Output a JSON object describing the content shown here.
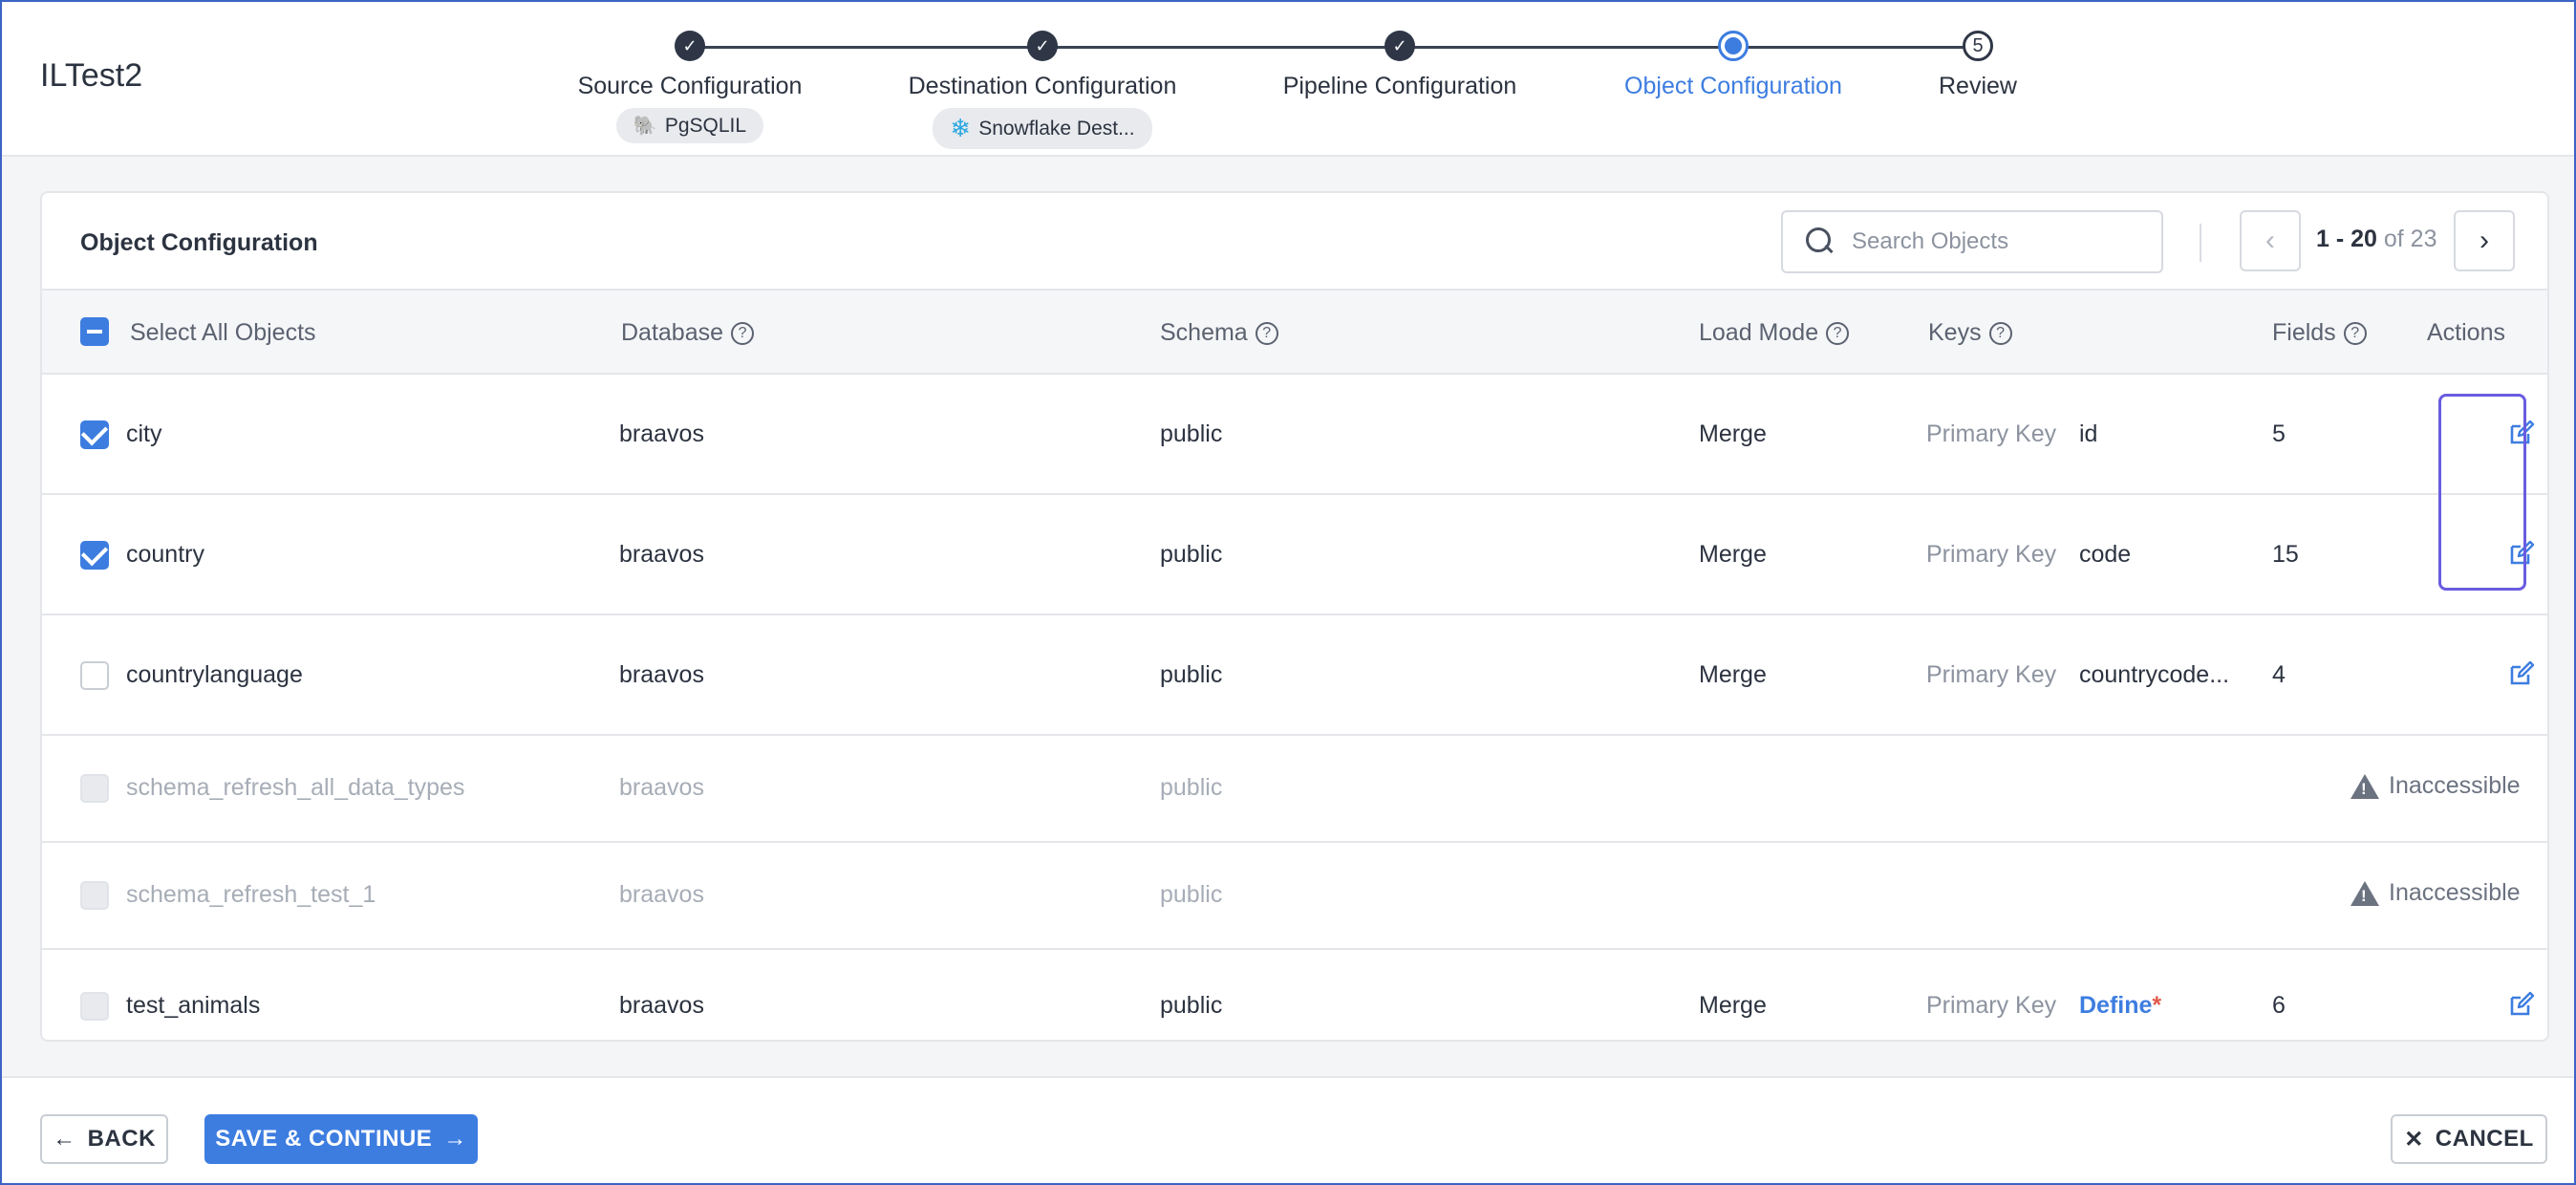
{
  "app": {
    "title": "ILTest2"
  },
  "stepper": [
    {
      "label": "Source Configuration",
      "state": "done",
      "chip": "PgSQLIL",
      "chip_icon": "postgres-icon"
    },
    {
      "label": "Destination Configuration",
      "state": "done",
      "chip": "Snowflake Dest...",
      "chip_icon": "snowflake-icon"
    },
    {
      "label": "Pipeline Configuration",
      "state": "done"
    },
    {
      "label": "Object Configuration",
      "state": "current"
    },
    {
      "label": "Review",
      "state": "pending",
      "number": "5"
    }
  ],
  "card": {
    "title": "Object Configuration",
    "search_placeholder": "Search Objects",
    "pagination": {
      "range": "1 - 20",
      "total": "of 23"
    }
  },
  "table": {
    "headers": {
      "select_all": "Select All Objects",
      "database": "Database",
      "schema": "Schema",
      "load_mode": "Load Mode",
      "keys": "Keys",
      "fields": "Fields",
      "actions": "Actions"
    },
    "rows": [
      {
        "name": "city",
        "database": "braavos",
        "schema": "public",
        "load_mode": "Merge",
        "key_type": "Primary Key",
        "key": "id",
        "fields": "5",
        "checked": true
      },
      {
        "name": "country",
        "database": "braavos",
        "schema": "public",
        "load_mode": "Merge",
        "key_type": "Primary Key",
        "key": "code",
        "fields": "15",
        "checked": true
      },
      {
        "name": "countrylanguage",
        "database": "braavos",
        "schema": "public",
        "load_mode": "Merge",
        "key_type": "Primary Key",
        "key": "countrycode...",
        "fields": "4",
        "checked": false
      },
      {
        "name": "schema_refresh_all_data_types",
        "database": "braavos",
        "schema": "public",
        "status": "Inaccessible"
      },
      {
        "name": "schema_refresh_test_1",
        "database": "braavos",
        "schema": "public",
        "status": "Inaccessible"
      },
      {
        "name": "test_animals",
        "database": "braavos",
        "schema": "public",
        "load_mode": "Merge",
        "key_type": "Primary Key",
        "key_action": "Define",
        "key_required": "*",
        "fields": "6",
        "checked": false
      }
    ]
  },
  "footer": {
    "back": "BACK",
    "save": "SAVE & CONTINUE",
    "cancel": "CANCEL"
  },
  "colors": {
    "accent": "#3d7de0",
    "dark": "#2f3747",
    "highlight": "#6a5ce0",
    "required": "#e05a4a"
  }
}
